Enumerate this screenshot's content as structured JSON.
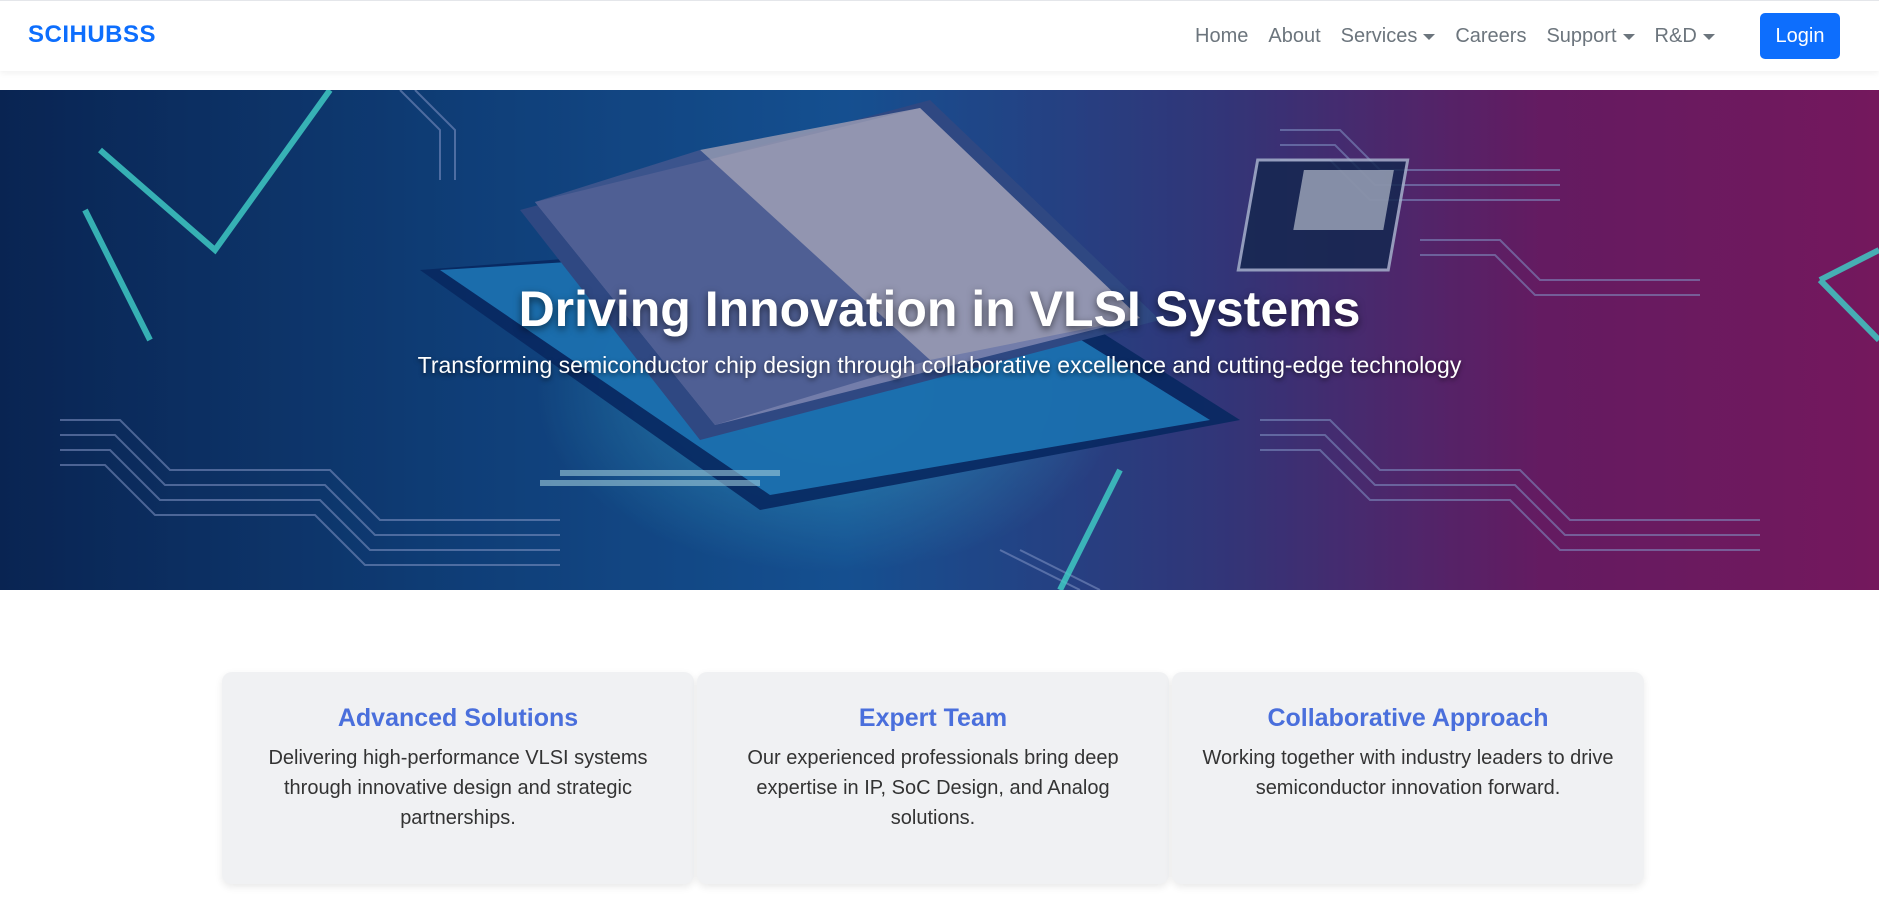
{
  "brand": "SCIHUBSS",
  "nav": {
    "items": [
      {
        "label": "Home"
      },
      {
        "label": "About"
      },
      {
        "label": "Services"
      },
      {
        "label": "Careers"
      },
      {
        "label": "Support"
      },
      {
        "label": "R&D"
      }
    ],
    "login_label": "Login"
  },
  "hero": {
    "title": "Driving Innovation in VLSI Systems",
    "subtitle": "Transforming semiconductor chip design through collaborative excellence and cutting-edge technology"
  },
  "features": [
    {
      "title": "Advanced Solutions",
      "text": "Delivering high-performance VLSI systems through innovative design and strategic partnerships."
    },
    {
      "title": "Expert Team",
      "text": "Our experienced professionals bring deep expertise in IP, SoC Design, and Analog solutions."
    },
    {
      "title": "Collaborative Approach",
      "text": "Working together with industry leaders to drive semiconductor innovation forward."
    }
  ],
  "colors": {
    "brand": "#0d6efd",
    "feature_title": "#4a6fdc",
    "card_bg": "#f0f1f3"
  }
}
